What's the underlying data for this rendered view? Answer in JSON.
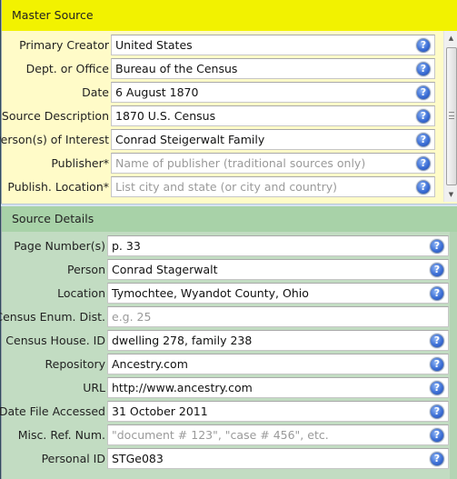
{
  "master_source": {
    "title": "Master Source",
    "fields": [
      {
        "label": "Primary Creator",
        "value": "United States",
        "placeholder": false,
        "help": true
      },
      {
        "label": "Dept. or Office",
        "value": "Bureau of the Census",
        "placeholder": false,
        "help": true
      },
      {
        "label": "Date",
        "value": "6 August 1870",
        "placeholder": false,
        "help": true
      },
      {
        "label": "Source Description",
        "value": "1870 U.S. Census",
        "placeholder": false,
        "help": true
      },
      {
        "label": "Person(s) of Interest",
        "value": "Conrad Steigerwalt Family",
        "placeholder": false,
        "help": true
      },
      {
        "label": "Publisher*",
        "value": "Name of publisher (traditional sources only)",
        "placeholder": true,
        "help": true
      },
      {
        "label": "Publish. Location*",
        "value": "List city and state (or city and country)",
        "placeholder": true,
        "help": true
      }
    ]
  },
  "source_details": {
    "title": "Source Details",
    "fields": [
      {
        "label": "Page Number(s)",
        "value": "p. 33",
        "placeholder": false,
        "help": true
      },
      {
        "label": "Person",
        "value": "Conrad Stagerwalt",
        "placeholder": false,
        "help": true
      },
      {
        "label": "Location",
        "value": "Tymochtee, Wyandot County, Ohio",
        "placeholder": false,
        "help": true
      },
      {
        "label": "Census Enum. Dist.",
        "value": "e.g. 25",
        "placeholder": true,
        "help": false
      },
      {
        "label": "Census House. ID",
        "value": "dwelling 278, family 238",
        "placeholder": false,
        "help": true
      },
      {
        "label": "Repository",
        "value": "Ancestry.com",
        "placeholder": false,
        "help": true
      },
      {
        "label": "URL",
        "value": "http://www.ancestry.com",
        "placeholder": false,
        "help": true
      },
      {
        "label": "Date File Accessed",
        "value": "31 October 2011",
        "placeholder": false,
        "help": true
      },
      {
        "label": "Misc. Ref. Num.",
        "value": "\"document # 123\", \"case # 456\", etc.",
        "placeholder": true,
        "help": true
      },
      {
        "label": "Personal ID",
        "value": "STGe083",
        "placeholder": false,
        "help": true
      }
    ]
  },
  "icons": {
    "help": "?",
    "scroll_up": "▲",
    "scroll_down": "▼"
  },
  "colors": {
    "master_header": "#f2f200",
    "master_body": "#fffbc8",
    "details_header": "#a8d2a8",
    "details_body": "#c2dcc2",
    "placeholder_text": "#9a9a9a"
  }
}
